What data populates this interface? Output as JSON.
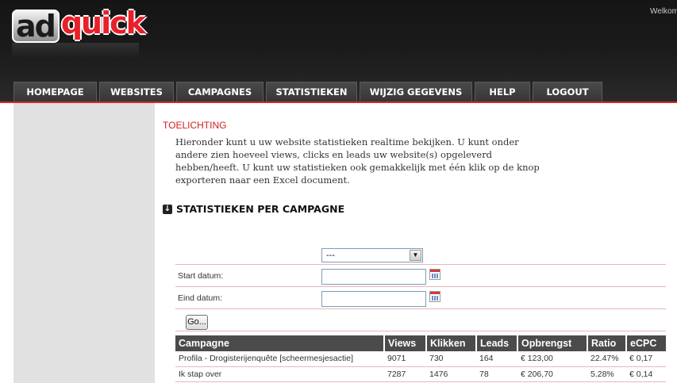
{
  "header": {
    "logo_left": "ad",
    "logo_right": "quick",
    "welcome_text": "Welkom"
  },
  "nav": [
    {
      "label": "HOMEPAGE"
    },
    {
      "label": "WEBSITES"
    },
    {
      "label": "CAMPAGNES"
    },
    {
      "label": "STATISTIEKEN"
    },
    {
      "label": "WIJZIG GEGEVENS"
    },
    {
      "label": "HELP"
    },
    {
      "label": "LOGOUT"
    }
  ],
  "toelichting": {
    "title": "TOELICHTING",
    "text": "Hieronder kunt u uw website statistieken realtime bekijken. U kunt onder andere zien hoeveel views, clicks en leads uw website(s) opgeleverd hebben/heeft. U kunt uw statistieken ook gemakkelijk met één klik op de knop exporteren naar een Excel document."
  },
  "section": {
    "title": "STATISTIEKEN PER CAMPAGNE"
  },
  "form": {
    "campaign_select_value": "---",
    "start_label": "Start datum:",
    "end_label": "Eind datum:",
    "start_value": "",
    "end_value": "",
    "go_label": "Go..."
  },
  "table": {
    "headers": [
      "Campagne",
      "Views",
      "Klikken",
      "Leads",
      "Opbrengst",
      "Ratio",
      "eCPC"
    ],
    "rows": [
      [
        "Profila - Drogisterijenquête [scheermesjesactie]",
        "9071",
        "730",
        "164",
        "€ 123,00",
        "22.47%",
        "€ 0,17"
      ],
      [
        "Ik stap over",
        "7287",
        "1476",
        "78",
        "€ 206,70",
        "5.28%",
        "€ 0,14"
      ]
    ]
  },
  "colors": {
    "accent": "#d42a2a",
    "header_bg": "#1a1a1a",
    "nav_bg": "#3f3f3f",
    "sidebar_bg": "#e1e1e1",
    "table_header_bg": "#4b4b4b"
  }
}
